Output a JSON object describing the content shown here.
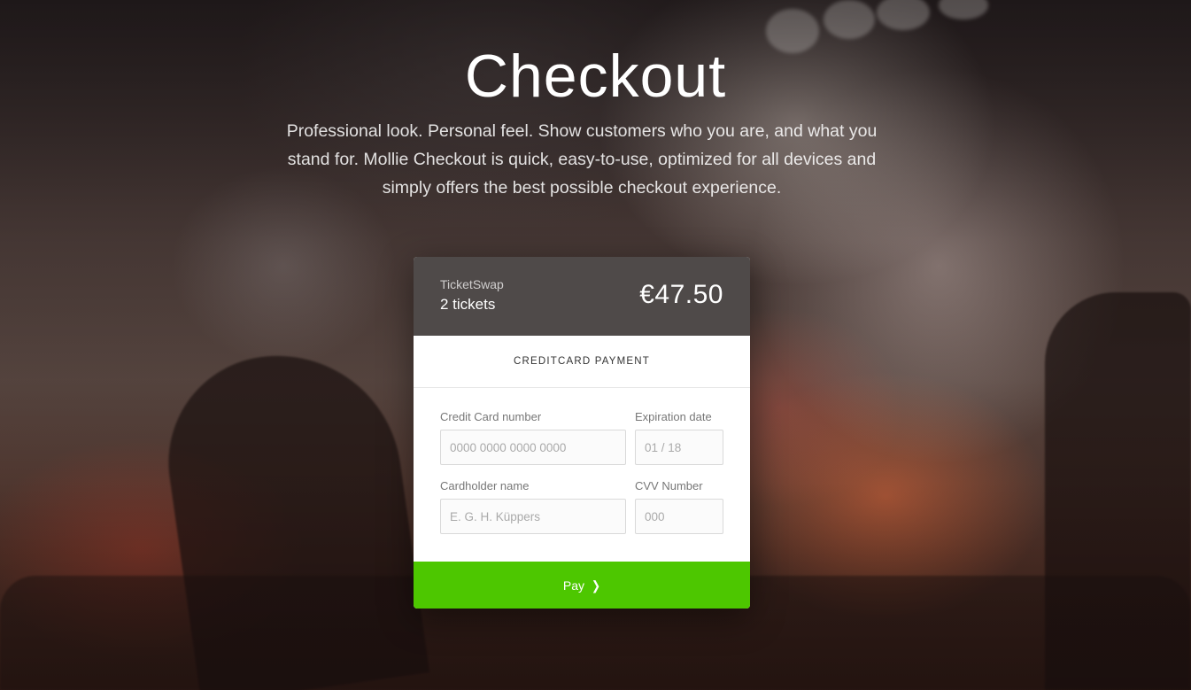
{
  "hero": {
    "title": "Checkout",
    "subtitle": "Professional look. Personal feel. Show customers who you are, and what you stand for. Mollie Checkout is quick, easy-to-use, optimized for all devices and simply offers the best possible checkout experience."
  },
  "checkout": {
    "merchant": "TicketSwap",
    "items": "2 tickets",
    "amount": "€47.50",
    "payment_method": "CREDITCARD PAYMENT",
    "fields": {
      "card_number": {
        "label": "Credit Card number",
        "placeholder": "0000 0000 0000 0000",
        "value": ""
      },
      "expiry": {
        "label": "Expiration date",
        "placeholder": "01 / 18",
        "value": ""
      },
      "holder": {
        "label": "Cardholder name",
        "placeholder": "E. G. H. Küppers",
        "value": ""
      },
      "cvv": {
        "label": "CVV Number",
        "placeholder": "000",
        "value": ""
      }
    },
    "pay_label": "Pay",
    "pay_icon": "chevron-right-icon"
  },
  "colors": {
    "pay_button": "#4dc700",
    "header_bg": "#443f3e"
  }
}
